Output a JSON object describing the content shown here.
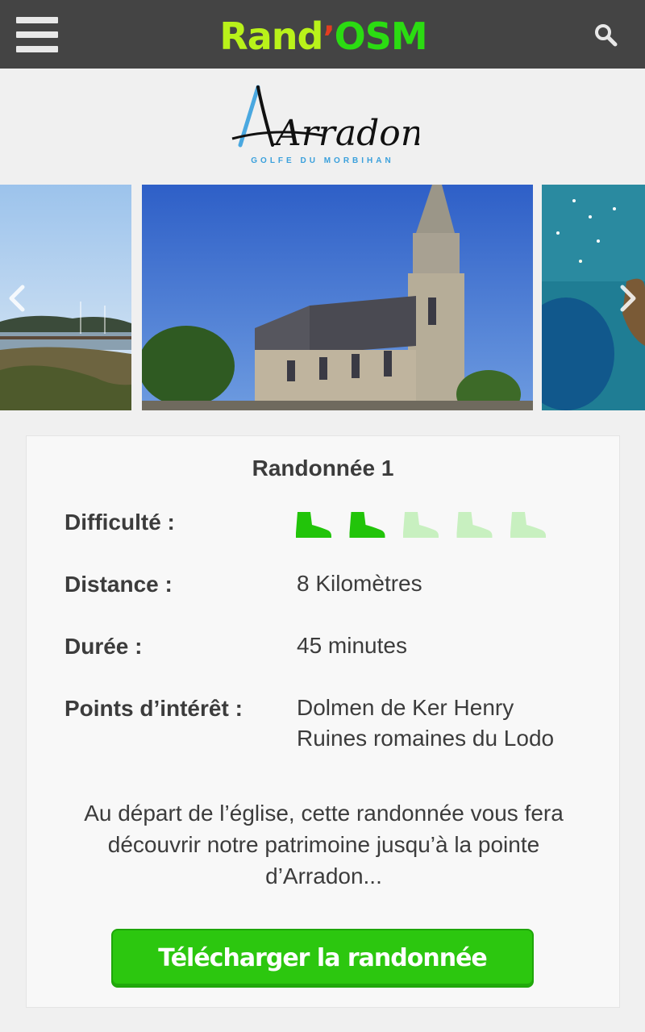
{
  "header": {
    "brand_part1": "Rand",
    "brand_part2": "’",
    "brand_part3": "OSM",
    "menu_icon": "hamburger-menu-icon",
    "search_icon": "search-icon"
  },
  "logo": {
    "name": "Arradon",
    "tagline": "GOLFE DU MORBIHAN"
  },
  "carousel": {
    "slides": [
      "harbor-photo",
      "church-photo",
      "aerial-sea-photo"
    ],
    "prev_icon": "chevron-left-icon",
    "next_icon": "chevron-right-icon"
  },
  "hike": {
    "title": "Randonnée 1",
    "difficulty_label": "Difficulté :",
    "difficulty_level": 2,
    "difficulty_max": 5,
    "distance_label": "Distance :",
    "distance_value": "8 Kilomètres",
    "duration_label": "Durée :",
    "duration_value": "45 minutes",
    "poi_label": "Points d’intérêt :",
    "poi_1": "Dolmen de Ker Henry",
    "poi_2": "Ruines romaines du Lodo",
    "description_line1": "Au départ de l’église, cette randonnée vous fera",
    "description_line2": "découvrir notre patrimoine jusqu’à la pointe",
    "description_line3": "d’Arradon...",
    "download_label": "Télécharger la randonnée"
  },
  "colors": {
    "topbar": "#444444",
    "accent_green": "#2cc70f",
    "boot_active": "#22c40a",
    "boot_inactive": "#c8f0c0"
  }
}
